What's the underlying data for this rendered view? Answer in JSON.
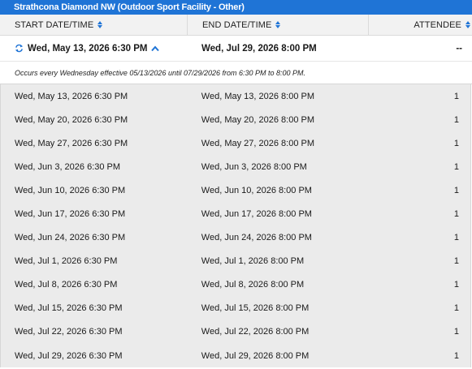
{
  "facility": {
    "title": "Strathcona Diamond NW (Outdoor Sport Facility - Other)"
  },
  "columns": {
    "start": "START DATE/TIME",
    "end": "END DATE/TIME",
    "attendee": "ATTENDEE"
  },
  "series": {
    "start": "Wed, May 13, 2026 6:30 PM",
    "end": "Wed, Jul 29, 2026 8:00 PM",
    "attendee": "--",
    "note": "Occurs every Wednesday effective 05/13/2026 until 07/29/2026 from 6:30 PM to 8:00 PM.",
    "icons": {
      "recurring": "repeat-icon",
      "collapse": "chevron-up-icon"
    }
  },
  "occurrences": [
    {
      "start": "Wed, May 13, 2026 6:30 PM",
      "end": "Wed, May 13, 2026 8:00 PM",
      "attendee": "1"
    },
    {
      "start": "Wed, May 20, 2026 6:30 PM",
      "end": "Wed, May 20, 2026 8:00 PM",
      "attendee": "1"
    },
    {
      "start": "Wed, May 27, 2026 6:30 PM",
      "end": "Wed, May 27, 2026 8:00 PM",
      "attendee": "1"
    },
    {
      "start": "Wed, Jun 3, 2026 6:30 PM",
      "end": "Wed, Jun 3, 2026 8:00 PM",
      "attendee": "1"
    },
    {
      "start": "Wed, Jun 10, 2026 6:30 PM",
      "end": "Wed, Jun 10, 2026 8:00 PM",
      "attendee": "1"
    },
    {
      "start": "Wed, Jun 17, 2026 6:30 PM",
      "end": "Wed, Jun 17, 2026 8:00 PM",
      "attendee": "1"
    },
    {
      "start": "Wed, Jun 24, 2026 6:30 PM",
      "end": "Wed, Jun 24, 2026 8:00 PM",
      "attendee": "1"
    },
    {
      "start": "Wed, Jul 1, 2026 6:30 PM",
      "end": "Wed, Jul 1, 2026 8:00 PM",
      "attendee": "1"
    },
    {
      "start": "Wed, Jul 8, 2026 6:30 PM",
      "end": "Wed, Jul 8, 2026 8:00 PM",
      "attendee": "1"
    },
    {
      "start": "Wed, Jul 15, 2026 6:30 PM",
      "end": "Wed, Jul 15, 2026 8:00 PM",
      "attendee": "1"
    },
    {
      "start": "Wed, Jul 22, 2026 6:30 PM",
      "end": "Wed, Jul 22, 2026 8:00 PM",
      "attendee": "1"
    },
    {
      "start": "Wed, Jul 29, 2026 6:30 PM",
      "end": "Wed, Jul 29, 2026 8:00 PM",
      "attendee": "1"
    }
  ],
  "colors": {
    "accent": "#1f74d6",
    "header_bg": "#f2f2f2",
    "list_bg": "#ebebeb"
  }
}
